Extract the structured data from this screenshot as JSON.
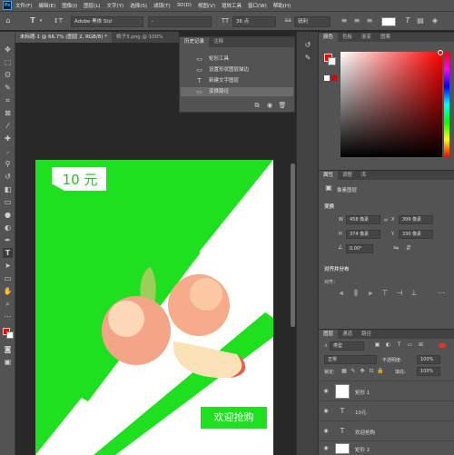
{
  "menu": [
    "文件(F)",
    "编辑(E)",
    "图像(I)",
    "图层(L)",
    "文字(Y)",
    "选择(S)",
    "滤镜(T)",
    "3D(D)",
    "视图(V)",
    "增效工具",
    "窗口(W)",
    "帮助(H)"
  ],
  "app_logo": "Ps",
  "options": {
    "font_family": "Adobe 黑体 Std",
    "font_style": "-",
    "font_size": "36 点",
    "antialias": "锐利",
    "color_hex": "#ffffff"
  },
  "document_tabs": [
    {
      "label": "未标题-1 @ 66.7% (图层 2, RGB/8) *",
      "active": true
    },
    {
      "label": "桃子3.png @ 100%",
      "active": false
    }
  ],
  "history_panel": {
    "tabs": [
      "历史记录",
      "注释"
    ],
    "items": [
      {
        "icon": "rect",
        "label": "矩形工具"
      },
      {
        "icon": "rect",
        "label": "设置形状图层描边"
      },
      {
        "icon": "T",
        "label": "新建文字图层"
      },
      {
        "icon": "T",
        "label": "变换路径",
        "selected": true
      }
    ]
  },
  "color_panel": {
    "tabs": [
      "颜色",
      "色板",
      "渐变",
      "图案"
    ],
    "foreground": "#ff0000",
    "background": "#ffffff"
  },
  "properties_panel": {
    "tabs": [
      "属性",
      "调整",
      "库"
    ],
    "layer_kind": "像素图层",
    "section_transform": "变换",
    "w": "458 像素",
    "x": "399 像素",
    "h": "374 像素",
    "y": "330 像素",
    "angle": "0.00°",
    "section_align": "对齐并分布",
    "align_label": "对齐："
  },
  "layers_panel": {
    "tabs": [
      "图层",
      "通道",
      "路径"
    ],
    "filter": "类型",
    "blend_mode": "正常",
    "opacity_label": "不透明度:",
    "opacity": "100%",
    "lock_label": "锁定:",
    "fill_label": "填充:",
    "fill": "100%",
    "layers": [
      {
        "name": "矩形 1",
        "type": "shape"
      },
      {
        "name": "10元",
        "type": "text"
      },
      {
        "name": "欢迎抢购",
        "type": "text"
      },
      {
        "name": "矩形 2",
        "type": "shape"
      }
    ]
  },
  "poster": {
    "price_text": "10 元",
    "button_text": "欢迎抢购",
    "accent_color": "#1ee01e"
  }
}
